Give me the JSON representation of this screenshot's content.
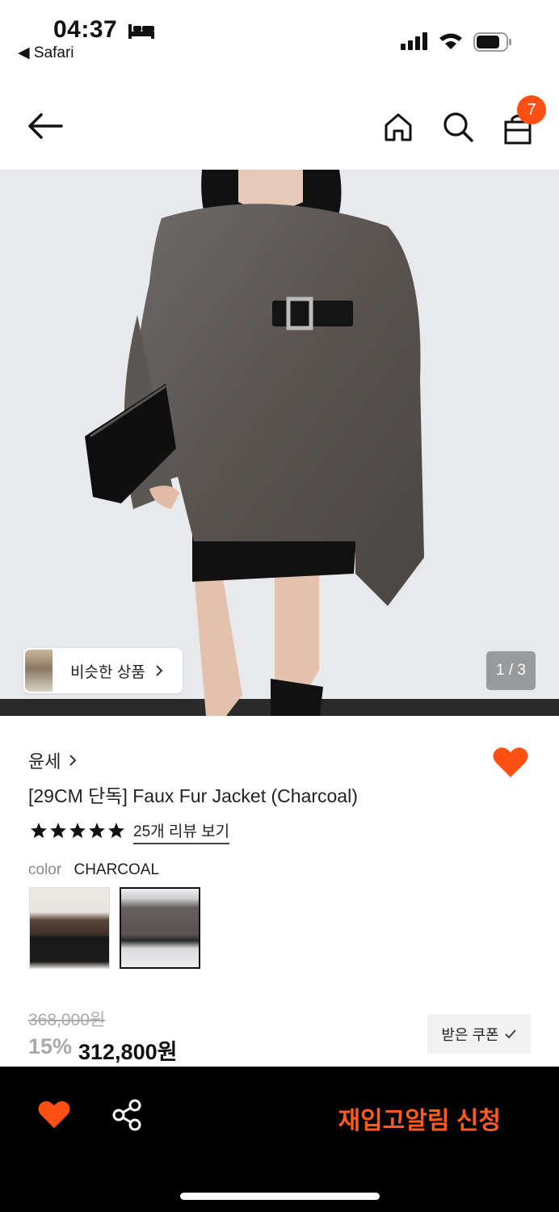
{
  "status_bar": {
    "time": "04:37",
    "back_app": "◀ Safari"
  },
  "header": {
    "cart_count": "7"
  },
  "hero": {
    "similar_label": "비슷한 상품",
    "pager": "1 / 3"
  },
  "product": {
    "brand": "윤세",
    "title": "[29CM 단독] Faux Fur Jacket (Charcoal)",
    "rating_stars": 5,
    "review_link": "25개 리뷰 보기",
    "color_label": "color",
    "color_value": "CHARCOAL",
    "original_price": "368,000원",
    "discount": "15%",
    "price": "312,800원",
    "coupon_label": "받은 쿠폰"
  },
  "bottom_bar": {
    "restock_label": "재입고알림 신청"
  },
  "colors": {
    "accent": "#ff4f12",
    "cta_text": "#ff5b1e"
  }
}
